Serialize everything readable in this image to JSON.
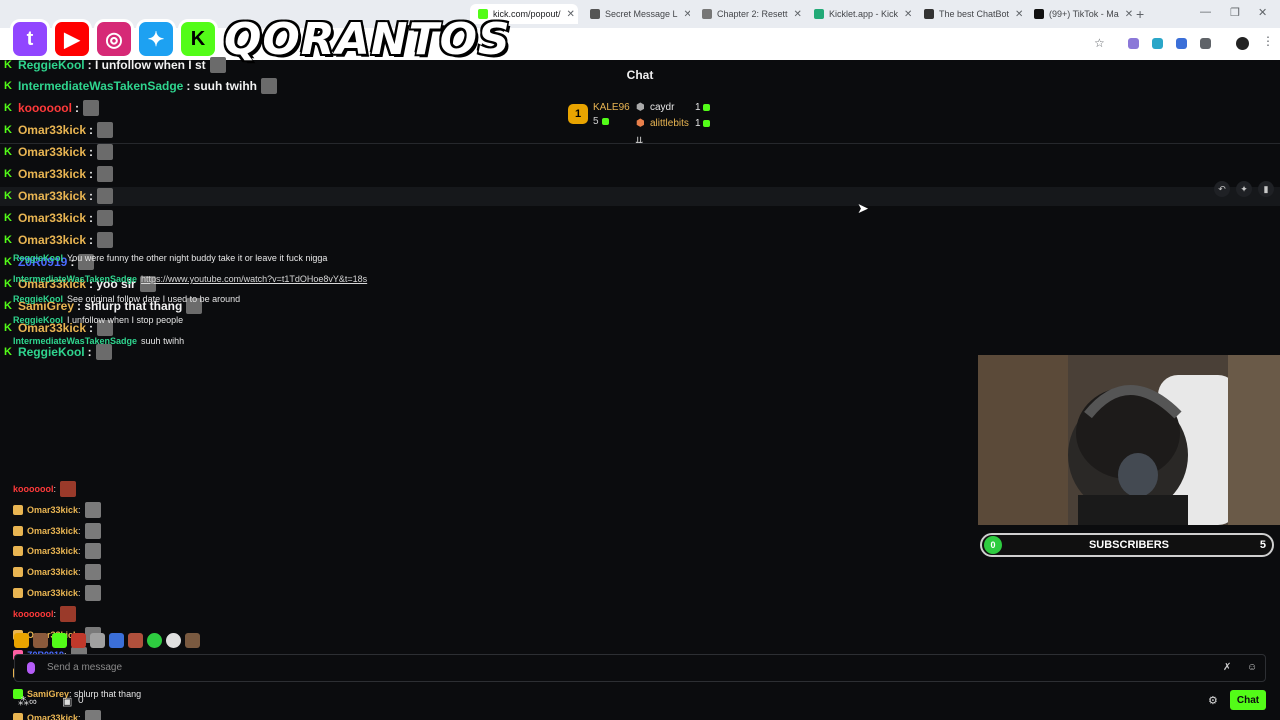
{
  "browser": {
    "tabs": [
      {
        "label": "kick.com/popout/",
        "active": true
      },
      {
        "label": "Secret Message L"
      },
      {
        "label": "Chapter 2: Resett"
      },
      {
        "label": "Kicklet.app - Kick"
      },
      {
        "label": "The best ChatBot"
      },
      {
        "label": "(99+) TikTok - Ma"
      }
    ]
  },
  "logo": {
    "brand": "QORANTOS"
  },
  "chat": {
    "title": "Chat",
    "leaderboard": {
      "first": {
        "rank": "1",
        "name": "KALE96",
        "count": "5"
      },
      "others": [
        {
          "name": "caydr",
          "count": "1"
        },
        {
          "name": "alittlebits",
          "count": "1"
        }
      ]
    },
    "overlay_messages": [
      {
        "user": "ReggieKool",
        "text": ": I unfollow when I st",
        "color": "#2fd58e"
      },
      {
        "user": "IntermediateWasTakenSadge",
        "text": ": suuh twihh",
        "color": "#2fd58e"
      },
      {
        "user": "kooooool",
        "text": ":",
        "color": "#ff3a3a"
      },
      {
        "user": "Omar33kick",
        "text": ":",
        "color": "#e9b552"
      },
      {
        "user": "Omar33kick",
        "text": ":",
        "color": "#e9b552"
      },
      {
        "user": "Omar33kick",
        "text": ":",
        "color": "#e9b552"
      },
      {
        "user": "Omar33kick",
        "text": ":",
        "color": "#e9b552"
      },
      {
        "user": "Omar33kick",
        "text": ":",
        "color": "#e9b552"
      },
      {
        "user": "Omar33kick",
        "text": ":",
        "color": "#e9b552"
      },
      {
        "user": "Z0R0919",
        "text": ":",
        "color": "#4a6bff"
      },
      {
        "user": "Omar33kick",
        "text": ": yoo sir",
        "color": "#e9b552"
      },
      {
        "user": "SamiGrey",
        "text": ": shlurp that thang",
        "color": "#e9b552"
      },
      {
        "user": "Omar33kick",
        "text": ":",
        "color": "#e9b552"
      },
      {
        "user": "ReggieKool",
        "text": ":",
        "color": "#2fd58e"
      }
    ],
    "mid_messages": [
      {
        "user": "ReggieKool",
        "text": "You were funny the other night buddy take it or leave it fuck nigga",
        "color": "#2fd58e"
      },
      {
        "user": "IntermediateWasTakenSadge",
        "text": "https://www.youtube.com/watch?v=t1TdOHoe8vY&t=18s",
        "color": "#2fd58e"
      },
      {
        "user": "ReggieKool",
        "text": "See original follow date   I used to be around",
        "color": "#2fd58e"
      },
      {
        "user": "ReggieKool",
        "text": "I unfollow when I stop   people",
        "color": "#2fd58e"
      },
      {
        "user": "IntermediateWasTakenSadge",
        "text": "suuh twihh",
        "color": "#2fd58e"
      }
    ],
    "recent_messages": [
      {
        "user": "kooooool",
        "text": ":",
        "color": "#ff3a3a"
      },
      {
        "user": "Omar33kick",
        "text": ":",
        "color": "#e9b552"
      },
      {
        "user": "Omar33kick",
        "text": ":",
        "color": "#e9b552"
      },
      {
        "user": "Omar33kick",
        "text": ":",
        "color": "#e9b552"
      },
      {
        "user": "Omar33kick",
        "text": ":",
        "color": "#e9b552"
      },
      {
        "user": "Omar33kick",
        "text": ":",
        "color": "#e9b552"
      },
      {
        "user": "kooooool",
        "text": ":",
        "color": "#ff3a3a"
      },
      {
        "user": "Omar33kick",
        "text": ":",
        "color": "#e9b552"
      },
      {
        "user": "Z0R0919",
        "text": ":",
        "color": "#4a6bff"
      },
      {
        "user": "Omar33kick",
        "text": ": yoo sir",
        "color": "#e9b552"
      },
      {
        "user": "SamiGrey",
        "text": ": shlurp that thang",
        "color": "#e9b552"
      },
      {
        "user": "Omar33kick",
        "text": ":",
        "color": "#e9b552"
      },
      {
        "user": "ReggieKool",
        "text": ":",
        "color": "#2fd58e"
      }
    ],
    "input_placeholder": "Send a message",
    "chat_button": "Chat",
    "bottom_count": "0"
  },
  "subscribers": {
    "label": "SUBSCRIBERS",
    "current": "0",
    "goal": "5"
  },
  "colors": {
    "kick_green": "#53fc18",
    "background": "#0b0c0e"
  }
}
